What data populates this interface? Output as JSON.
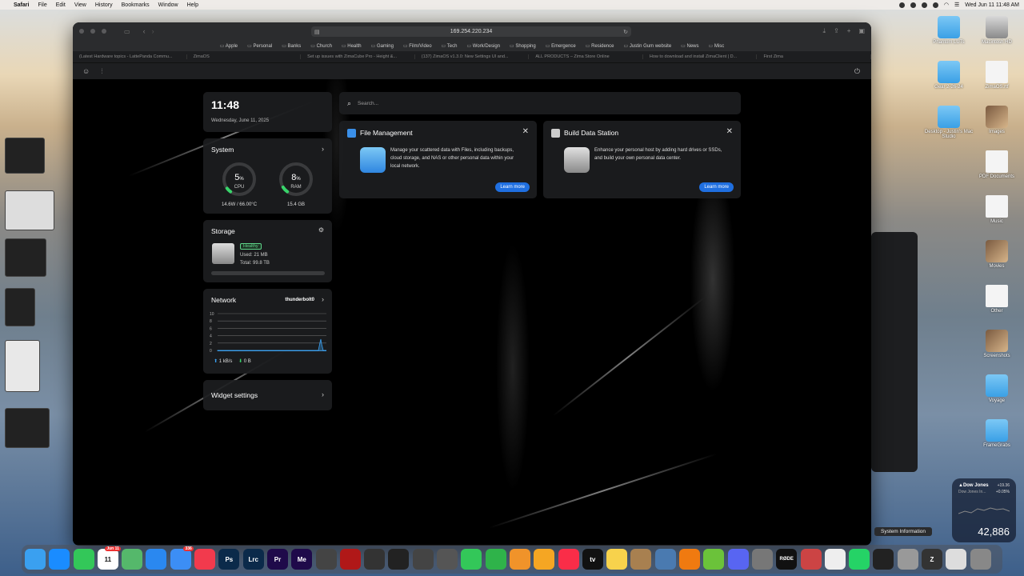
{
  "menubar": {
    "app": "Safari",
    "items": [
      "File",
      "Edit",
      "View",
      "History",
      "Bookmarks",
      "Window",
      "Help"
    ],
    "clock": "Wed Jun 11  11:48 AM"
  },
  "desktop": [
    {
      "label": "Phantom LUTs",
      "kind": "folder"
    },
    {
      "label": "Macintosh HD",
      "kind": "drive"
    },
    {
      "label": "Gear 2-26-24",
      "kind": "folder"
    },
    {
      "label": "ZimaOS.rtf",
      "kind": "doc"
    },
    {
      "label": "Desktop - Justin's Mac Studio",
      "kind": "folder"
    },
    {
      "label": "Images",
      "kind": "photo"
    },
    {
      "label": "PDF Documents",
      "kind": "doc"
    },
    {
      "label": "Music",
      "kind": "doc"
    },
    {
      "label": "Movies",
      "kind": "photo"
    },
    {
      "label": "Other",
      "kind": "doc"
    },
    {
      "label": "Screenshots",
      "kind": "photo"
    },
    {
      "label": "Voyage",
      "kind": "folder"
    },
    {
      "label": "FrameGrabs",
      "kind": "folder"
    }
  ],
  "browser": {
    "url": "169.254.220.234",
    "bookmarks": [
      "Apple",
      "Personal",
      "Banks",
      "Church",
      "Health",
      "Gaming",
      "Film/Video",
      "Tech",
      "Work/Design",
      "Shopping",
      "Emergence",
      "Residence",
      "Justin Gum website",
      "News",
      "Misc"
    ],
    "tabs": [
      "(Latest Hardware topics - LattePanda Commu...",
      "ZimaOS",
      "Set up issues with ZimaCube Pro - Height &...",
      "(137) ZimaOS v1.3.0: New Settings UI and...",
      "ALL PRODUCTS – Zima Store Online",
      "How to download and install ZimaClient | D...",
      "First Zima"
    ]
  },
  "dashboard": {
    "clock": {
      "time": "11:48",
      "date": "Wednesday, June 11, 2025"
    },
    "system": {
      "title": "System",
      "cpu": {
        "value": "5",
        "unit": "%",
        "label": "CPU",
        "fraction": 0.05,
        "sub": "14.6W / 66.00°C"
      },
      "ram": {
        "value": "8",
        "unit": "%",
        "label": "RAM",
        "fraction": 0.08,
        "sub": "15.4 GB"
      }
    },
    "storage": {
      "title": "Storage",
      "status": "Healthy",
      "used": "Used: 21 MB",
      "total": "Total: 99.8 TB",
      "used_fraction": 0.0002
    },
    "network": {
      "title": "Network",
      "iface": "thunderbolt0",
      "yticks": [
        "10",
        "8",
        "6",
        "4",
        "2",
        "0"
      ],
      "up": "1 kB/s",
      "down": "0 B"
    },
    "widget_settings": "Widget settings",
    "search_placeholder": "Search...",
    "apps": [
      {
        "title": "File Management",
        "desc": "Manage your scattered data with Files, including backups, cloud storage, and NAS or other personal data within your local network.",
        "button": "Learn more",
        "color": "#3a8fe8"
      },
      {
        "title": "Build Data Station",
        "desc": "Enhance your personal host by adding hard drives or SSDs, and build your own personal data center.",
        "button": "Learn more",
        "color": "#bdbdbd"
      }
    ]
  },
  "stock_widget": {
    "name": "▲Dow Jones",
    "sub": "Dow Jones In...",
    "change": "+19.36",
    "percent": "+0.05%",
    "value": "42,886"
  },
  "tooltip": "System Information",
  "dock": [
    {
      "name": "finder",
      "color": "#3aa0f0"
    },
    {
      "name": "app-store",
      "color": "#1a8cff"
    },
    {
      "name": "messages",
      "color": "#33c759"
    },
    {
      "name": "calendar",
      "color": "#ffffff",
      "text": "11",
      "badge": "Jun 11"
    },
    {
      "name": "maps",
      "color": "#55b86b"
    },
    {
      "name": "safari",
      "color": "#2a88f0"
    },
    {
      "name": "mail",
      "color": "#3c8ef5",
      "badge": "336"
    },
    {
      "name": "news",
      "color": "#f23a4d"
    },
    {
      "name": "photoshop",
      "color": "#0b2a4a",
      "text": "Ps"
    },
    {
      "name": "lightroom-classic",
      "color": "#0b2a4a",
      "text": "Lrc"
    },
    {
      "name": "premiere",
      "color": "#1f0a4a",
      "text": "Pr"
    },
    {
      "name": "media-encoder",
      "color": "#1f0a4a",
      "text": "Me"
    },
    {
      "name": "quicktime",
      "color": "#444"
    },
    {
      "name": "record",
      "color": "#b01818"
    },
    {
      "name": "davinci",
      "color": "#333"
    },
    {
      "name": "final-cut",
      "color": "#222"
    },
    {
      "name": "motion",
      "color": "#444"
    },
    {
      "name": "compressor",
      "color": "#555"
    },
    {
      "name": "facetime",
      "color": "#33c759"
    },
    {
      "name": "numbers",
      "color": "#2fb34a"
    },
    {
      "name": "pages",
      "color": "#f0932a"
    },
    {
      "name": "photos",
      "color": "#f5a623"
    },
    {
      "name": "music",
      "color": "#fa2d48"
    },
    {
      "name": "apple-tv",
      "color": "#111",
      "text": "tv"
    },
    {
      "name": "notes",
      "color": "#f7d24c"
    },
    {
      "name": "archive",
      "color": "#a88050"
    },
    {
      "name": "preview",
      "color": "#4a7ab0"
    },
    {
      "name": "vlc",
      "color": "#f07a10"
    },
    {
      "name": "cloud-app",
      "color": "#6bc23a"
    },
    {
      "name": "discord",
      "color": "#5865f2"
    },
    {
      "name": "system-settings",
      "color": "#777"
    },
    {
      "name": "rode",
      "color": "#111",
      "text": "RØDE"
    },
    {
      "name": "pencil-app",
      "color": "#c44"
    },
    {
      "name": "textedit",
      "color": "#eee"
    },
    {
      "name": "whatsapp",
      "color": "#25d366"
    },
    {
      "name": "chatgpt",
      "color": "#222"
    },
    {
      "name": "system-information",
      "color": "#999"
    },
    {
      "name": "zima",
      "color": "#333",
      "text": "Z"
    },
    {
      "name": "document",
      "color": "#ddd"
    },
    {
      "name": "trash",
      "color": "#888"
    }
  ]
}
